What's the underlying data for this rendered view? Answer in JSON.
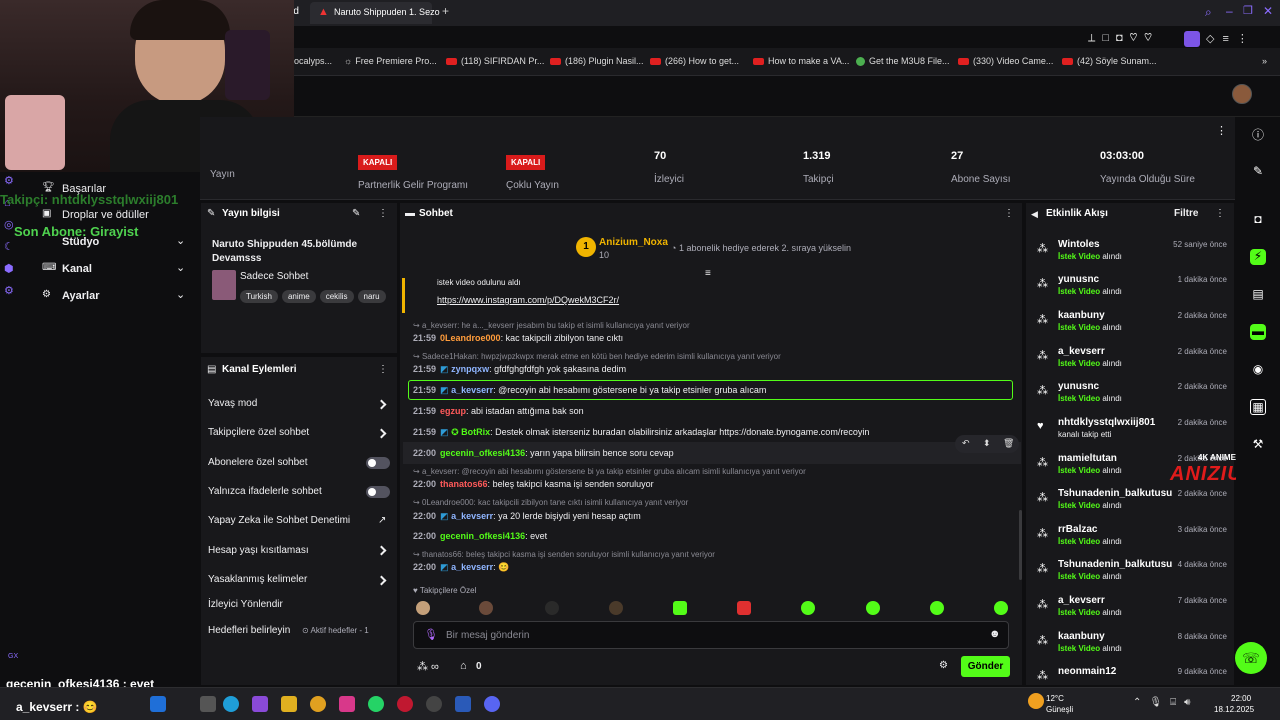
{
  "browser": {
    "tab_prefix": "rd",
    "active_tab": "Naruto Shippuden 1. Sezo",
    "new_tab": "+",
    "bookmarks": [
      "ocalyps...",
      "Free Premiere Pro...",
      "(118) SIFIRDAN Pr...",
      "(186) Plugin Nasil...",
      "(266) How to get...",
      "How to make a VA...",
      "Get the M3U8 File...",
      "(330) Video Came...",
      "(42) Söyle Sunam..."
    ]
  },
  "overlay": {
    "takipci": "Takipçi: nhtdklysstqlwxiij801",
    "son_abone": "Son Abone: Girayist",
    "chat_line": "gecenin_ofkesi4136 : evet",
    "chat_line2": "a_kevserr : 😊",
    "gx": "GX"
  },
  "leftnav": {
    "items": [
      {
        "label": "Başarılar"
      },
      {
        "label": "Droplar ve ödüller"
      },
      {
        "label": "Stüdyo"
      },
      {
        "label": "Kanal"
      },
      {
        "label": "Ayarlar"
      }
    ],
    "header_fragment": "leri"
  },
  "stats": [
    {
      "value": "",
      "label": "Yayın"
    },
    {
      "value": "KAPALI",
      "label": "Partnerlik Gelir Programı"
    },
    {
      "value": "KAPALI",
      "label": "Çoklu Yayın"
    },
    {
      "value": "70",
      "label": "İzleyici"
    },
    {
      "value": "1.319",
      "label": "Takipçi"
    },
    {
      "value": "27",
      "label": "Abone Sayısı"
    },
    {
      "value": "03:03:00",
      "label": "Yayında Olduğu Süre"
    }
  ],
  "stream_info": {
    "header": "Yayın bilgisi",
    "title": "Naruto Shippuden 45.bölümde Devamsss",
    "category": "Sadece Sohbet",
    "tags": [
      "Turkish",
      "anime",
      "cekilis",
      "naru"
    ]
  },
  "channel_actions": {
    "header": "Kanal Eylemleri",
    "items": [
      {
        "label": "Yavaş mod",
        "kind": "chevron"
      },
      {
        "label": "Takipçilere özel sohbet",
        "kind": "chevron"
      },
      {
        "label": "Abonelere özel sohbet",
        "kind": "toggle"
      },
      {
        "label": "Yalnızca ifadelerle sohbet",
        "kind": "toggle"
      },
      {
        "label": "Yapay Zeka ile Sohbet Denetimi",
        "kind": "external"
      },
      {
        "label": "Hesap yaşı kısıtlaması",
        "kind": "chevron"
      },
      {
        "label": "Yasaklanmış kelimeler",
        "kind": "chevron"
      },
      {
        "label": "İzleyici Yönlendir",
        "kind": "none"
      },
      {
        "label": "Hedefleri belirleyin",
        "kind": "badge",
        "badge": "Aktif hedefler - 1"
      }
    ]
  },
  "chat": {
    "header": "Sohbet",
    "gifter": {
      "rank": "1",
      "name": "Anizium_Noxa",
      "count": "10"
    },
    "gift_notice": "1 abonelik hediye ederek 2. sıraya yükselin",
    "pinned_fragment": "istek video odulunu aldı",
    "pinned_link": "https://www.instagram.com/p/DQwekM3CF2r/",
    "messages": [
      {
        "reply": "a_kevserr: he a..._kevserr jesabım bu takip et isimli kullanıcıya yanıt veriyor",
        "time": "21:59",
        "user": "0Leandroe000",
        "text": "kac takipcili zibilyon tane cıktı",
        "color": "#ff9c3b"
      },
      {
        "reply": "Sadece1Hakan: hwpzjwpzkwpx merak etme en kötü ben hediye ederim isimli kullanıcıya yanıt veriyor",
        "time": "21:59",
        "user": "zynpqxw",
        "text": "gfdfghgfdfgh yok şakasına dedim",
        "color": "#8fb5ff"
      },
      {
        "reply": "",
        "time": "21:59",
        "user": "a_kevserr",
        "text": "@recoyin abi hesabımı göstersene bi ya takip etsinler gruba alıcam",
        "color": "#8fb5ff"
      },
      {
        "reply": "",
        "time": "21:59",
        "user": "egzup",
        "text": "abi istadan attığıma bak son",
        "color": "#ff5a5a"
      },
      {
        "reply": "",
        "time": "21:59",
        "user": "BotRix",
        "text": "Destek olmak isterseniz buradan olabilirsiniz arkadaşlar https://donate.bynogame.com/recoyin",
        "color": "#53fc18"
      },
      {
        "reply": "",
        "time": "22:00",
        "user": "gecenin_ofkesi4136",
        "text": "yarın yapa bilirsin bence soru cevap",
        "color": "#53fc18"
      },
      {
        "reply": "a_kevserr: @recoyin abi hesabımı göstersene bi ya takip etsinler gruba alıcam isimli kullanıcıya yanıt veriyor",
        "time": "22:00",
        "user": "thanatos66",
        "text": "beleş takipci kasma işi senden soruluyor",
        "color": "#ff5a5a"
      },
      {
        "reply": "0Leandroe000: kac takipcili zibilyon tane cıktı isimli kullanıcıya yanıt veriyor",
        "time": "22:00",
        "user": "a_kevserr",
        "text": "ya 20 lerde bişiydi yeni hesap açtım",
        "color": "#8fb5ff"
      },
      {
        "reply": "",
        "time": "22:00",
        "user": "gecenin_ofkesi4136",
        "text": "evet",
        "color": "#53fc18"
      },
      {
        "reply": "thanatos66: beleş takipci kasma işi senden soruluyor isimli kullanıcıya yanıt veriyor",
        "time": "22:00",
        "user": "a_kevserr",
        "text": "😊",
        "color": "#8fb5ff"
      }
    ],
    "followers_only": "Takipçilere Özel",
    "input_placeholder": "Bir mesaj gönderin",
    "points": "0",
    "send": "Gönder"
  },
  "activity": {
    "header": "Etkinlik Akışı",
    "filter": "Filtre",
    "events": [
      {
        "name": "Wintoles",
        "time": "52 saniye önce",
        "kind": "reward"
      },
      {
        "name": "yunusnc",
        "time": "1 dakika önce",
        "kind": "reward"
      },
      {
        "name": "kaanbuny",
        "time": "2 dakika önce",
        "kind": "reward"
      },
      {
        "name": "a_kevserr",
        "time": "2 dakika önce",
        "kind": "reward"
      },
      {
        "name": "yunusnc",
        "time": "2 dakika önce",
        "kind": "reward"
      },
      {
        "name": "nhtdklysstqlwxiij801",
        "time": "2 dakika önce",
        "kind": "follow"
      },
      {
        "name": "mamieltutan",
        "time": "2 dakika önce",
        "kind": "reward"
      },
      {
        "name": "Tshunadenin_balkutusu",
        "time": "2 dakika önce",
        "kind": "reward"
      },
      {
        "name": "rrBalzac",
        "time": "3 dakika önce",
        "kind": "reward"
      },
      {
        "name": "Tshunadenin_balkutusu",
        "time": "4 dakika önce",
        "kind": "reward"
      },
      {
        "name": "a_kevserr",
        "time": "7 dakika önce",
        "kind": "reward"
      },
      {
        "name": "kaanbuny",
        "time": "8 dakika önce",
        "kind": "reward"
      },
      {
        "name": "neonmain12",
        "time": "9 dakika önce",
        "kind": "none"
      }
    ],
    "reward_prefix": "İstek Video",
    "reward_suffix": "alındı",
    "follow_text": "kanalı takip etti"
  },
  "watermark": {
    "line1": "4K ANIME MOVIE",
    "line2": "ANIZIUM"
  },
  "taskbar": {
    "weather_temp": "12°C",
    "weather_text": "Güneşli",
    "time": "22:00",
    "date": "18.12.2025"
  },
  "colors": {
    "accent": "#53fc18",
    "danger": "#d91b1b",
    "panel": "#18181b"
  }
}
